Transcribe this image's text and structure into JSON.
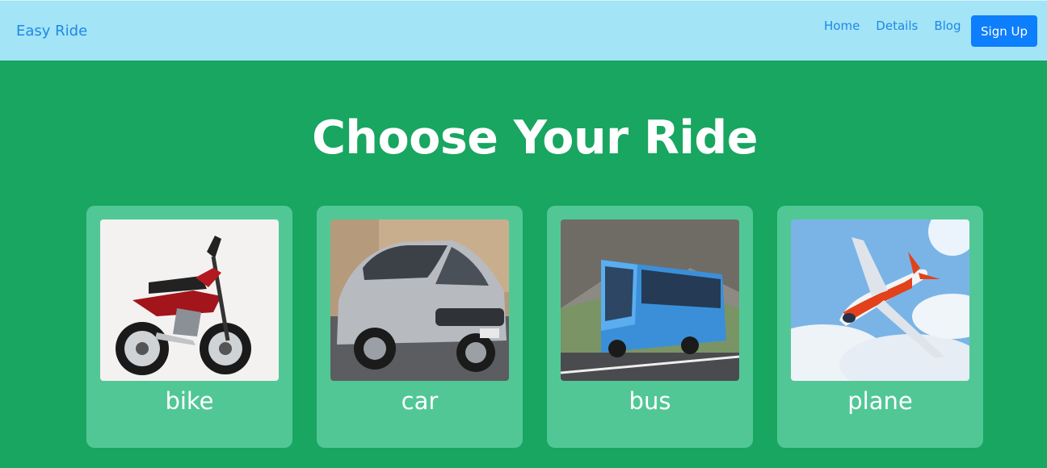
{
  "navbar": {
    "brand": "Easy Ride",
    "links": [
      "Home",
      "Details",
      "Blog"
    ],
    "signup_label": "Sign Up"
  },
  "main": {
    "heading": "Choose Your Ride",
    "rides": [
      {
        "label": "bike",
        "icon": "motorcycle-image"
      },
      {
        "label": "car",
        "icon": "car-image"
      },
      {
        "label": "bus",
        "icon": "bus-image"
      },
      {
        "label": "plane",
        "icon": "plane-image"
      }
    ]
  },
  "colors": {
    "navbar_bg": "#a3e4f7",
    "page_bg": "#18a660",
    "card_bg": "#52c796",
    "link": "#1e88e5",
    "button": "#0d7efc"
  }
}
